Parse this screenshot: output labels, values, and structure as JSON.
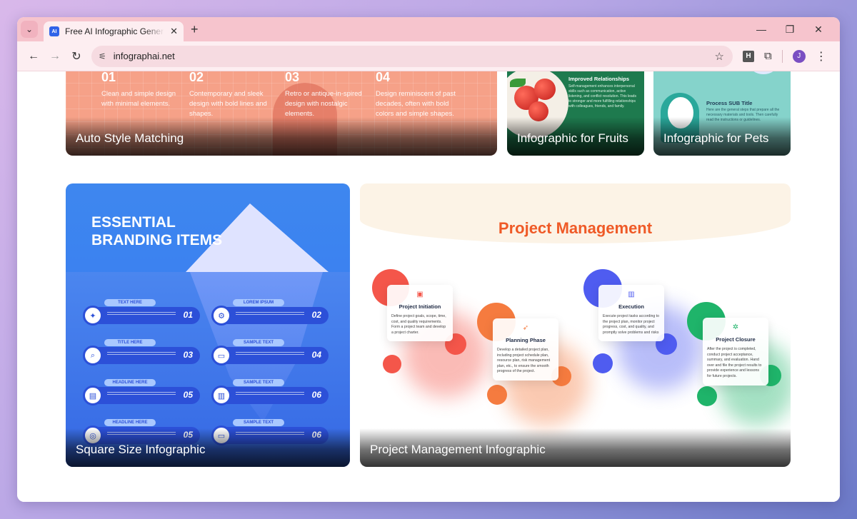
{
  "browser": {
    "tab_title": "Free AI Infographic Generator -",
    "tab_favicon": "AI",
    "url": "infographai.net",
    "avatar_letter": "J",
    "extension_letter": "H"
  },
  "cards": {
    "auto": {
      "caption": "Auto Style Matching",
      "steps": [
        {
          "num": "01",
          "desc": "Clean and simple design with minimal elements."
        },
        {
          "num": "02",
          "desc": "Contemporary and sleek design with bold lines and shapes."
        },
        {
          "num": "03",
          "desc": "Retro or antique-in-spired design with nostalgic elements."
        },
        {
          "num": "04",
          "desc": "Design reminiscent of past decades, often with bold colors and simple shapes."
        }
      ]
    },
    "fruits": {
      "caption": "Infographic for Fruits",
      "heading": "Improved Relationships",
      "text": "Self-management enhances interpersonal skills such as communication, active listening, and conflict resolution. This leads to stronger and more fulfilling relationships with colleagues, friends, and family."
    },
    "pets": {
      "caption": "Infographic for Pets",
      "heading": "Process SUB Title",
      "text": "Here are the general steps that prepare all the necessary materials and tools. Then carefully read the instructions or guidelines."
    },
    "square": {
      "caption": "Square Size Infographic",
      "title_line1": "ESSENTIAL",
      "title_line2": "BRANDING ITEMS",
      "items": [
        {
          "tag": "TEXT HERE",
          "num": "01",
          "icon": "lightbulb-icon",
          "glyph": "✦"
        },
        {
          "tag": "LOREM IPSUM",
          "num": "02",
          "icon": "gear-icon",
          "glyph": "⚙"
        },
        {
          "tag": "TITLE HERE",
          "num": "03",
          "icon": "search-icon",
          "glyph": "⌕"
        },
        {
          "tag": "SAMPLE TEXT",
          "num": "04",
          "icon": "monitor-icon",
          "glyph": "▭"
        },
        {
          "tag": "HEADLINE HERE",
          "num": "05",
          "icon": "clipboard-icon",
          "glyph": "▤"
        },
        {
          "tag": "SAMPLE TEXT",
          "num": "06",
          "icon": "chart-icon",
          "glyph": "▥"
        },
        {
          "tag": "HEADLINE HERE",
          "num": "05",
          "icon": "target-icon",
          "glyph": "◎"
        },
        {
          "tag": "SAMPLE TEXT",
          "num": "06",
          "icon": "monitor-icon",
          "glyph": "▭"
        }
      ]
    },
    "project": {
      "caption": "Project Management Infographic",
      "title": "Project Management",
      "phases": [
        {
          "title": "Project Initiation",
          "text": "Define project goals, scope, time, cost, and quality requirements. Form a project team and develop a project charter.",
          "color": "#f4564a",
          "icon": "▣"
        },
        {
          "title": "Planning Phase",
          "text": "Develop a detailed project plan, including project schedule plan, resource plan, risk management plan, etc., to ensure the smooth progress of the project.",
          "color": "#f57b3f",
          "icon": "➶"
        },
        {
          "title": "Execution",
          "text": "Execute project tasks according to the project plan, monitor project progress, cost, and quality, and promptly solve problems and risks",
          "color": "#4f5cf0",
          "icon": "▥"
        },
        {
          "title": "Project Closure",
          "text": "After the project is completed, conduct project acceptance, summary, and evaluation. Hand over and file the project results to provide experience and lessons for future projects.",
          "color": "#1fb46a",
          "icon": "✲"
        }
      ]
    }
  }
}
